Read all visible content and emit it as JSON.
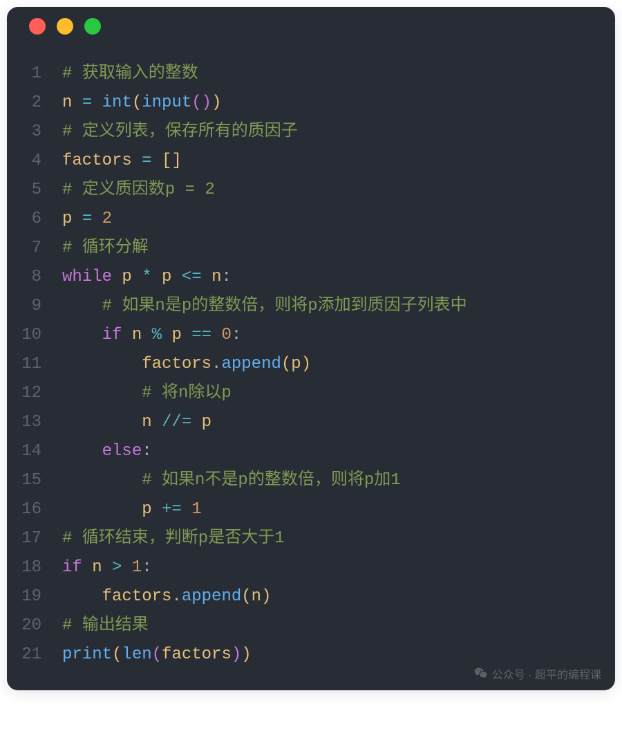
{
  "code": {
    "lines": [
      {
        "num": "1",
        "tokens": [
          {
            "cls": "comment",
            "txt": "# 获取输入的整数"
          }
        ]
      },
      {
        "num": "2",
        "tokens": [
          {
            "cls": "variable",
            "txt": "n"
          },
          {
            "cls": "text",
            "txt": " "
          },
          {
            "cls": "operator",
            "txt": "="
          },
          {
            "cls": "text",
            "txt": " "
          },
          {
            "cls": "function",
            "txt": "int"
          },
          {
            "cls": "paren-yellow",
            "txt": "("
          },
          {
            "cls": "function",
            "txt": "input"
          },
          {
            "cls": "paren-purple",
            "txt": "()"
          },
          {
            "cls": "paren-yellow",
            "txt": ")"
          }
        ]
      },
      {
        "num": "3",
        "tokens": [
          {
            "cls": "comment",
            "txt": "# 定义列表，保存所有的质因子"
          }
        ]
      },
      {
        "num": "4",
        "tokens": [
          {
            "cls": "variable",
            "txt": "factors"
          },
          {
            "cls": "text",
            "txt": " "
          },
          {
            "cls": "operator",
            "txt": "="
          },
          {
            "cls": "text",
            "txt": " "
          },
          {
            "cls": "paren-yellow",
            "txt": "[]"
          }
        ]
      },
      {
        "num": "5",
        "tokens": [
          {
            "cls": "comment",
            "txt": "# 定义质因数p = 2"
          }
        ]
      },
      {
        "num": "6",
        "tokens": [
          {
            "cls": "variable",
            "txt": "p"
          },
          {
            "cls": "text",
            "txt": " "
          },
          {
            "cls": "operator",
            "txt": "="
          },
          {
            "cls": "text",
            "txt": " "
          },
          {
            "cls": "number",
            "txt": "2"
          }
        ]
      },
      {
        "num": "7",
        "tokens": [
          {
            "cls": "comment",
            "txt": "# 循环分解"
          }
        ]
      },
      {
        "num": "8",
        "tokens": [
          {
            "cls": "keyword",
            "txt": "while"
          },
          {
            "cls": "text",
            "txt": " "
          },
          {
            "cls": "variable",
            "txt": "p"
          },
          {
            "cls": "text",
            "txt": " "
          },
          {
            "cls": "operator",
            "txt": "*"
          },
          {
            "cls": "text",
            "txt": " "
          },
          {
            "cls": "variable",
            "txt": "p"
          },
          {
            "cls": "text",
            "txt": " "
          },
          {
            "cls": "operator",
            "txt": "<="
          },
          {
            "cls": "text",
            "txt": " "
          },
          {
            "cls": "variable",
            "txt": "n"
          },
          {
            "cls": "punct",
            "txt": ":"
          }
        ]
      },
      {
        "num": "9",
        "tokens": [
          {
            "cls": "text",
            "txt": "    "
          },
          {
            "cls": "comment",
            "txt": "# 如果n是p的整数倍，则将p添加到质因子列表中"
          }
        ]
      },
      {
        "num": "10",
        "tokens": [
          {
            "cls": "text",
            "txt": "    "
          },
          {
            "cls": "keyword",
            "txt": "if"
          },
          {
            "cls": "text",
            "txt": " "
          },
          {
            "cls": "variable",
            "txt": "n"
          },
          {
            "cls": "text",
            "txt": " "
          },
          {
            "cls": "operator",
            "txt": "%"
          },
          {
            "cls": "text",
            "txt": " "
          },
          {
            "cls": "variable",
            "txt": "p"
          },
          {
            "cls": "text",
            "txt": " "
          },
          {
            "cls": "operator",
            "txt": "=="
          },
          {
            "cls": "text",
            "txt": " "
          },
          {
            "cls": "number",
            "txt": "0"
          },
          {
            "cls": "punct",
            "txt": ":"
          }
        ]
      },
      {
        "num": "11",
        "tokens": [
          {
            "cls": "text",
            "txt": "        "
          },
          {
            "cls": "variable",
            "txt": "factors"
          },
          {
            "cls": "punct",
            "txt": "."
          },
          {
            "cls": "method",
            "txt": "append"
          },
          {
            "cls": "paren-yellow",
            "txt": "("
          },
          {
            "cls": "variable",
            "txt": "p"
          },
          {
            "cls": "paren-yellow",
            "txt": ")"
          }
        ]
      },
      {
        "num": "12",
        "tokens": [
          {
            "cls": "text",
            "txt": "        "
          },
          {
            "cls": "comment",
            "txt": "# 将n除以p"
          }
        ]
      },
      {
        "num": "13",
        "tokens": [
          {
            "cls": "text",
            "txt": "        "
          },
          {
            "cls": "variable",
            "txt": "n"
          },
          {
            "cls": "text",
            "txt": " "
          },
          {
            "cls": "operator",
            "txt": "//="
          },
          {
            "cls": "text",
            "txt": " "
          },
          {
            "cls": "variable",
            "txt": "p"
          }
        ]
      },
      {
        "num": "14",
        "tokens": [
          {
            "cls": "text",
            "txt": "    "
          },
          {
            "cls": "keyword",
            "txt": "else"
          },
          {
            "cls": "punct",
            "txt": ":"
          }
        ]
      },
      {
        "num": "15",
        "tokens": [
          {
            "cls": "text",
            "txt": "        "
          },
          {
            "cls": "comment",
            "txt": "# 如果n不是p的整数倍，则将p加1"
          }
        ]
      },
      {
        "num": "16",
        "tokens": [
          {
            "cls": "text",
            "txt": "        "
          },
          {
            "cls": "variable",
            "txt": "p"
          },
          {
            "cls": "text",
            "txt": " "
          },
          {
            "cls": "operator",
            "txt": "+="
          },
          {
            "cls": "text",
            "txt": " "
          },
          {
            "cls": "number",
            "txt": "1"
          }
        ]
      },
      {
        "num": "17",
        "tokens": [
          {
            "cls": "comment",
            "txt": "# 循环结束，判断p是否大于1"
          }
        ]
      },
      {
        "num": "18",
        "tokens": [
          {
            "cls": "keyword",
            "txt": "if"
          },
          {
            "cls": "text",
            "txt": " "
          },
          {
            "cls": "variable",
            "txt": "n"
          },
          {
            "cls": "text",
            "txt": " "
          },
          {
            "cls": "operator",
            "txt": ">"
          },
          {
            "cls": "text",
            "txt": " "
          },
          {
            "cls": "number",
            "txt": "1"
          },
          {
            "cls": "punct",
            "txt": ":"
          }
        ]
      },
      {
        "num": "19",
        "tokens": [
          {
            "cls": "text",
            "txt": "    "
          },
          {
            "cls": "variable",
            "txt": "factors"
          },
          {
            "cls": "punct",
            "txt": "."
          },
          {
            "cls": "method",
            "txt": "append"
          },
          {
            "cls": "paren-yellow",
            "txt": "("
          },
          {
            "cls": "variable",
            "txt": "n"
          },
          {
            "cls": "paren-yellow",
            "txt": ")"
          }
        ]
      },
      {
        "num": "20",
        "tokens": [
          {
            "cls": "comment",
            "txt": "# 输出结果"
          }
        ]
      },
      {
        "num": "21",
        "tokens": [
          {
            "cls": "function",
            "txt": "print"
          },
          {
            "cls": "paren-yellow",
            "txt": "("
          },
          {
            "cls": "function",
            "txt": "len"
          },
          {
            "cls": "paren-purple",
            "txt": "("
          },
          {
            "cls": "variable",
            "txt": "factors"
          },
          {
            "cls": "paren-purple",
            "txt": ")"
          },
          {
            "cls": "paren-yellow",
            "txt": ")"
          }
        ]
      }
    ]
  },
  "watermark": {
    "text": "公众号 · 超平的编程课"
  }
}
